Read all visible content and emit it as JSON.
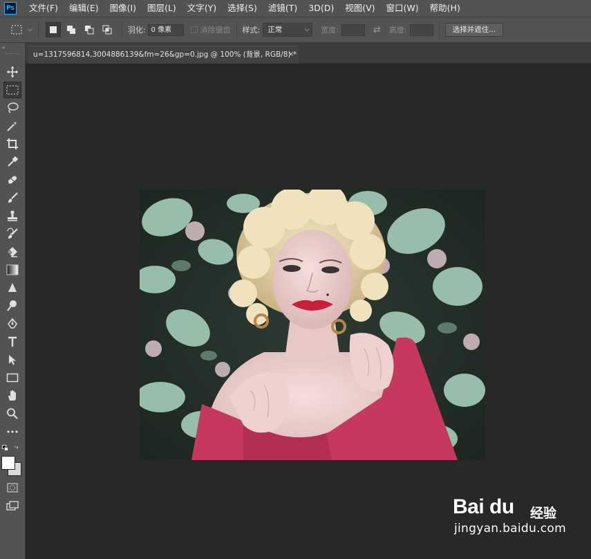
{
  "app": {
    "logo_text": "Ps"
  },
  "menu": {
    "items": [
      "文件(F)",
      "编辑(E)",
      "图像(I)",
      "图层(L)",
      "文字(Y)",
      "选择(S)",
      "滤镜(T)",
      "3D(D)",
      "视图(V)",
      "窗口(W)",
      "帮助(H)"
    ]
  },
  "options": {
    "feather_label": "羽化:",
    "feather_value": "0 像素",
    "antialias_label": "消除锯齿",
    "style_label": "样式:",
    "style_value": "正常",
    "width_label": "宽度:",
    "height_label": "高度:",
    "select_mask_button": "选择并遮住..."
  },
  "document": {
    "tab_title": "u=1317596814,3004886139&fm=26&gp=0.jpg @ 100% (背景, RGB/8) *",
    "close_glyph": "×"
  },
  "tools": [
    "move-tool-icon",
    "rectangular-marquee-tool-icon",
    "lasso-tool-icon",
    "magic-wand-tool-icon",
    "crop-tool-icon",
    "eyedropper-tool-icon",
    "healing-brush-tool-icon",
    "brush-tool-icon",
    "clone-stamp-tool-icon",
    "history-brush-tool-icon",
    "eraser-tool-icon",
    "gradient-tool-icon",
    "blur-tool-icon",
    "dodge-tool-icon",
    "pen-tool-icon",
    "type-tool-icon",
    "path-selection-tool-icon",
    "rectangle-tool-icon",
    "hand-tool-icon",
    "zoom-tool-icon",
    "edit-toolbar-icon"
  ],
  "colors": {
    "ui_panel": "#535353",
    "workspace": "#282828",
    "foreground": "#ffffff",
    "background": "#d9d9d9",
    "accent": "#31a8ff"
  },
  "watermark": {
    "brand": "Bai du",
    "brand_suffix": "经验",
    "url": "jingyan.baidu.com"
  }
}
